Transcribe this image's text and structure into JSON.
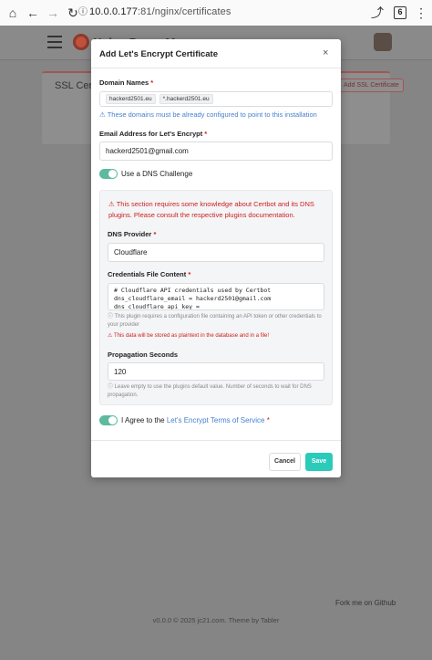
{
  "browser": {
    "url_host": "10.0.0.177",
    "url_path": ":81/nginx/certificates",
    "tab_count": "6"
  },
  "background": {
    "brand": "Nginx Proxy Manager",
    "card_title": "SSL Certificates",
    "card_button": "Add SSL Certificate",
    "footer_link": "Fork me on Github",
    "footer_text": "v0.0.0 © 2025 jc21.com. Theme by Tabler"
  },
  "modal": {
    "title": "Add Let's Encrypt Certificate",
    "close": "×",
    "domain_label": "Domain Names",
    "domains": [
      "hackerd2501.eu",
      "*.hackerd2501.eu"
    ],
    "domain_hint": "These domains must be already configured to point to this installation",
    "email_label": "Email Address for Let's Encrypt",
    "email_value": "hackerd2501@gmail.com",
    "dns_toggle_label": "Use a DNS Challenge",
    "dns_warning": "This section requires some knowledge about Certbot and its DNS plugins. Please consult the respective plugins documentation.",
    "dns_provider_label": "DNS Provider",
    "dns_provider_value": "Cloudflare",
    "credentials_label": "Credentials File Content",
    "credentials_value": "# Cloudflare API credentials used by Certbot\ndns_cloudflare_email = hackerd2501@gmail.com\ndns_cloudflare_api_key = ",
    "credentials_hint": "This plugin requires a configuration file containing an API token or other credentials to your provider",
    "credentials_warning": "This data will be stored as plaintext in the database and in a file!",
    "propagation_label": "Propagation Seconds",
    "propagation_value": "120",
    "propagation_hint": "Leave empty to use the plugins default value. Number of seconds to wait for DNS propagation.",
    "agree_prefix": "I Agree to the",
    "agree_link": "Let's Encrypt Terms of Service",
    "required_mark": "*",
    "cancel_label": "Cancel",
    "save_label": "Save"
  },
  "colors": {
    "accent_teal": "#2bcbba",
    "toggle_green": "#5eba9e",
    "link_blue": "#467fcf",
    "danger_red": "#cd201f"
  },
  "icons": {
    "home": "home-icon",
    "back": "arrow-left-icon",
    "forward": "arrow-right-icon",
    "reload": "reload-icon",
    "info": "info-icon",
    "share": "share-icon",
    "menu": "kebab-menu-icon",
    "warning": "warning-icon",
    "circle-info": "circle-info-icon"
  }
}
